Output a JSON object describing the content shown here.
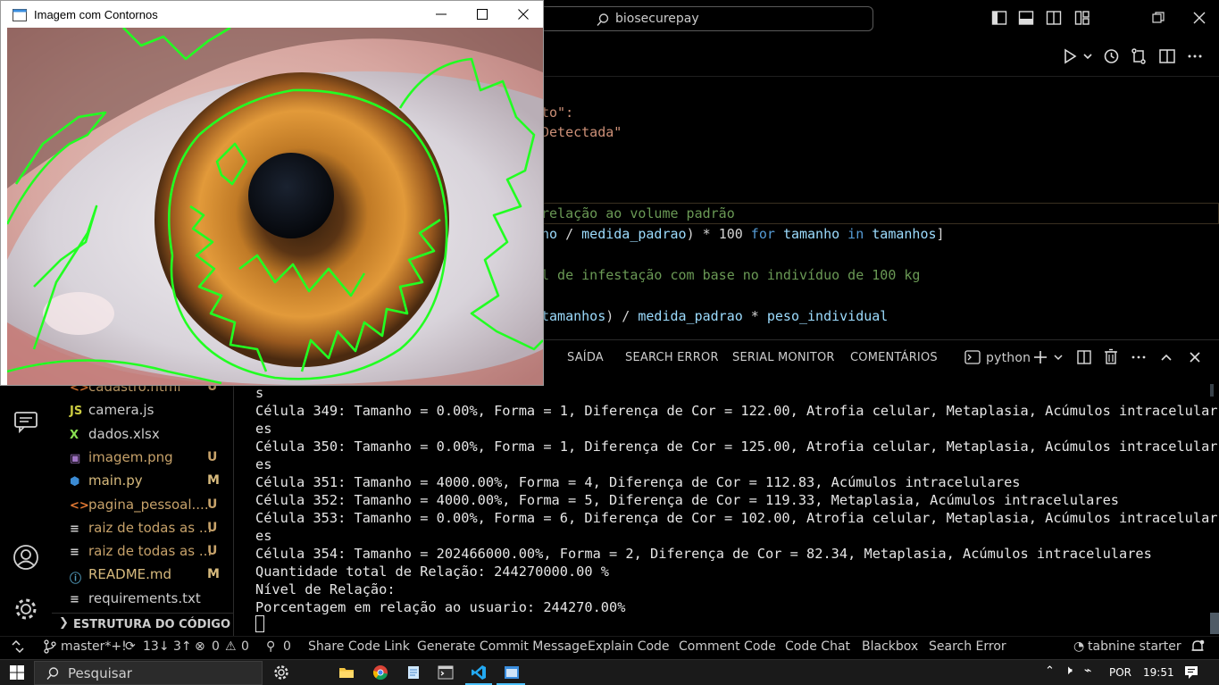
{
  "titlebar": {
    "search_label": "biosecurepay"
  },
  "editor": {
    "lines": [
      {
        "parts": [
          {
            "t": "to\":",
            "c": "str"
          }
        ]
      },
      {
        "parts": [
          {
            "t": "Detectada\"",
            "c": "str"
          }
        ]
      },
      {
        "parts": [
          {
            "t": "relação ao volume padrão",
            "c": "com"
          }
        ]
      },
      {
        "parts": [
          {
            "t": "ho",
            "c": "var"
          },
          {
            "t": " / ",
            "c": "op"
          },
          {
            "t": "medida_padrao",
            "c": "var"
          },
          {
            "t": ") * ",
            "c": "op"
          },
          {
            "t": "100",
            "c": "op"
          },
          {
            "t": " for ",
            "c": "kw"
          },
          {
            "t": "tamanho",
            "c": "var"
          },
          {
            "t": " in ",
            "c": "kw"
          },
          {
            "t": "tamanhos",
            "c": "var"
          },
          {
            "t": "]",
            "c": "op"
          }
        ]
      },
      {
        "parts": [
          {
            "t": "l de infestação com base no indivíduo de 100 kg",
            "c": "com"
          }
        ]
      },
      {
        "parts": [
          {
            "t": "tamanhos",
            "c": "var"
          },
          {
            "t": ") / ",
            "c": "op"
          },
          {
            "t": "medida_padrao",
            "c": "var"
          },
          {
            "t": " * ",
            "c": "op"
          },
          {
            "t": "peso_individual",
            "c": "var"
          }
        ]
      }
    ]
  },
  "panel": {
    "tabs": [
      "SAÍDA",
      "SEARCH ERROR",
      "SERIAL MONITOR",
      "COMENTÁRIOS"
    ],
    "terminal_name": "python"
  },
  "terminal": {
    "lines": [
      "s",
      "Célula 349: Tamanho = 0.00%, Forma = 1, Diferença de Cor = 122.00, Atrofia celular, Metaplasia, Acúmulos intracelular",
      "es",
      "Célula 350: Tamanho = 0.00%, Forma = 1, Diferença de Cor = 125.00, Atrofia celular, Metaplasia, Acúmulos intracelular",
      "es",
      "Célula 351: Tamanho = 4000.00%, Forma = 4, Diferença de Cor = 112.83, Acúmulos intracelulares",
      "Célula 352: Tamanho = 4000.00%, Forma = 5, Diferença de Cor = 119.33, Metaplasia, Acúmulos intracelulares",
      "Célula 353: Tamanho = 0.00%, Forma = 6, Diferença de Cor = 102.00, Atrofia celular, Metaplasia, Acúmulos intracelular",
      "es",
      "Célula 354: Tamanho = 202466000.00%, Forma = 2, Diferença de Cor = 82.34, Metaplasia, Acúmulos intracelulares",
      "Quantidade total de Relação: 244270000.00 %",
      "Nível de Relação:",
      "Porcentagem em relação ao usuario: 244270.00%"
    ]
  },
  "explorer": {
    "files": [
      {
        "name": "cadastro.html",
        "icon": "<>",
        "icon_color": "#e37933",
        "color": "#c7a26a",
        "badge": "U",
        "badge_color": "#c7a26a"
      },
      {
        "name": "camera.js",
        "icon": "JS",
        "icon_color": "#cbcb41",
        "color": "#cccccc",
        "badge": "",
        "badge_color": "#cccccc"
      },
      {
        "name": "dados.xlsx",
        "icon": "X",
        "icon_color": "#89e051",
        "color": "#cccccc",
        "badge": "",
        "badge_color": "#cccccc"
      },
      {
        "name": "imagem.png",
        "icon": "▣",
        "icon_color": "#a074c4",
        "color": "#c7a26a",
        "badge": "U",
        "badge_color": "#c7a26a"
      },
      {
        "name": "main.py",
        "icon": "⬢",
        "icon_color": "#3b8bd4",
        "color": "#d7ba7d",
        "badge": "M",
        "badge_color": "#d7ba7d"
      },
      {
        "name": "pagina_pessoal....",
        "icon": "<>",
        "icon_color": "#e37933",
        "color": "#c7a26a",
        "badge": "U",
        "badge_color": "#c7a26a"
      },
      {
        "name": "raiz de todas as ...",
        "icon": "≡",
        "icon_color": "#cccccc",
        "color": "#c7a26a",
        "badge": "U",
        "badge_color": "#c7a26a"
      },
      {
        "name": "raiz de todas as ...",
        "icon": "≡",
        "icon_color": "#cccccc",
        "color": "#c7a26a",
        "badge": "U",
        "badge_color": "#c7a26a"
      },
      {
        "name": "README.md",
        "icon": "ⓘ",
        "icon_color": "#519aba",
        "color": "#d7ba7d",
        "badge": "M",
        "badge_color": "#d7ba7d"
      },
      {
        "name": "requirements.txt",
        "icon": "≡",
        "icon_color": "#cccccc",
        "color": "#cccccc",
        "badge": "",
        "badge_color": "#cccccc"
      }
    ],
    "structure_header": "ESTRUTURA DO CÓDIGO"
  },
  "statusbar": {
    "branch": "master*+!",
    "sync": "13↓ 3↑",
    "errors": "0",
    "warnings": "0",
    "ports": "0",
    "items": [
      "Share Code Link",
      "Generate Commit Message",
      "Explain Code",
      "Comment Code",
      "Code Chat",
      "Blackbox",
      "Search Error"
    ],
    "tabnine": "tabnine starter"
  },
  "taskbar": {
    "search_placeholder": "Pesquisar",
    "language": "POR",
    "time": "19:51"
  },
  "cv_window": {
    "title": "Imagem com Contornos"
  },
  "colors": {
    "contour": "#22ff22",
    "accent": "#0078d4"
  }
}
